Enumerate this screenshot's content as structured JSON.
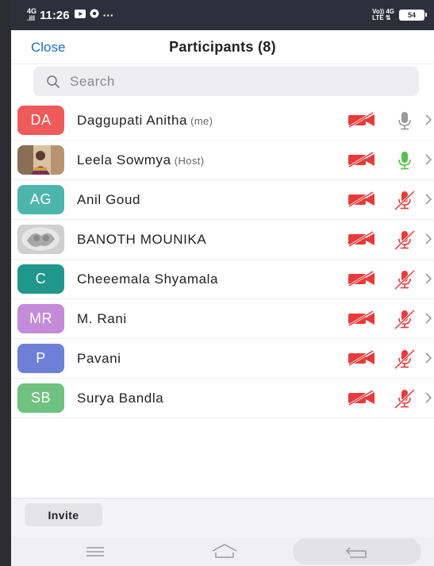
{
  "status_bar": {
    "network_top": "4G",
    "network_bottom": ".ill",
    "time": "11:26",
    "right_top": "Vo)) 4G",
    "right_bottom": "LTE ⇅",
    "battery": "54"
  },
  "header": {
    "close_label": "Close",
    "title": "Participants (8)"
  },
  "search": {
    "placeholder": "Search"
  },
  "participants": [
    {
      "initials": "DA",
      "name": "Daggupati Anitha",
      "tag": "(me)",
      "avatar_color": "#ef5a5a",
      "avatar_type": "initials",
      "video": "off",
      "mic": "available"
    },
    {
      "initials": "",
      "name": "Leela Sowmya",
      "tag": "(Host)",
      "avatar_color": "#c79a6b",
      "avatar_type": "photo",
      "video": "off",
      "mic": "active"
    },
    {
      "initials": "AG",
      "name": "Anil Goud",
      "tag": "",
      "avatar_color": "#4db6ac",
      "avatar_type": "initials",
      "video": "off",
      "mic": "muted"
    },
    {
      "initials": "",
      "name": "BANOTH MOUNIKA",
      "tag": "",
      "avatar_color": "#b8b8b8",
      "avatar_type": "photo",
      "video": "off",
      "mic": "muted"
    },
    {
      "initials": "C",
      "name": "Cheeemala Shyamala",
      "tag": "",
      "avatar_color": "#21968a",
      "avatar_type": "initials",
      "video": "off",
      "mic": "muted"
    },
    {
      "initials": "MR",
      "name": "M. Rani",
      "tag": "",
      "avatar_color": "#c38bd8",
      "avatar_type": "initials",
      "video": "off",
      "mic": "muted"
    },
    {
      "initials": "P",
      "name": "Pavani",
      "tag": "",
      "avatar_color": "#6d7fd6",
      "avatar_type": "initials",
      "video": "off",
      "mic": "muted"
    },
    {
      "initials": "SB",
      "name": "Surya Bandla",
      "tag": "",
      "avatar_color": "#6fc27f",
      "avatar_type": "initials",
      "video": "off",
      "mic": "muted"
    }
  ],
  "bottom": {
    "invite_label": "Invite"
  },
  "colors": {
    "accent": "#1b6ec2",
    "muted_red": "#e83a3a",
    "mic_active": "#5bbf4f",
    "mic_idle": "#9a9a9a"
  },
  "icons": {
    "camera": "video-off-icon",
    "mic_muted": "mic-muted-icon",
    "mic_active": "mic-active-icon",
    "mic_idle": "mic-idle-icon",
    "chevron": "chevron-right-icon",
    "search": "search-icon"
  }
}
